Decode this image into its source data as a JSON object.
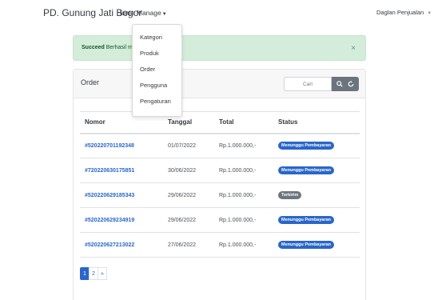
{
  "navbar": {
    "brand": "PD. Gunung Jati Bogor",
    "links": [
      "Home",
      "Manage"
    ],
    "user_menu": "Daglan Penjualan"
  },
  "dropdown": {
    "items": [
      "Kategori",
      "Produk",
      "Order",
      "Pengguna",
      "Pengaturan"
    ]
  },
  "alert": {
    "strong": "Succeed",
    "text": "Berhasil mela",
    "close": "×"
  },
  "card": {
    "title": "Order",
    "search_placeholder": "Cari"
  },
  "table": {
    "headers": [
      "Nomor",
      "Tanggal",
      "Total",
      "Status"
    ],
    "rows": [
      {
        "nomor": "#520220701192348",
        "tanggal": "01/07/2022",
        "total": "Rp.1.000.000,-",
        "status": "Menunggu Pembayaran",
        "status_color": "#2a66c9"
      },
      {
        "nomor": "#720220630175851",
        "tanggal": "30/06/2022",
        "total": "Rp.1.000.000,-",
        "status": "Menunggu Pembayaran",
        "status_color": "#2a66c9"
      },
      {
        "nomor": "#520220629185343",
        "tanggal": "29/06/2022",
        "total": "Rp.1.000.000,-",
        "status": "Terkirim",
        "status_color": "#6c757d"
      },
      {
        "nomor": "#520220629234919",
        "tanggal": "29/06/2022",
        "total": "Rp.1.000.000,-",
        "status": "Menunggu Pembayaran",
        "status_color": "#2a66c9"
      },
      {
        "nomor": "#520220627213022",
        "tanggal": "27/06/2022",
        "total": "Rp.1.000.000,-",
        "status": "Menunggu Pembayaran",
        "status_color": "#2a66c9"
      }
    ]
  },
  "pagination": {
    "pages": [
      "1",
      "2",
      "»"
    ],
    "active": "1"
  },
  "colors": {
    "primary": "#2a66c9",
    "success_bg": "#d4edda",
    "secondary": "#6c757d"
  }
}
